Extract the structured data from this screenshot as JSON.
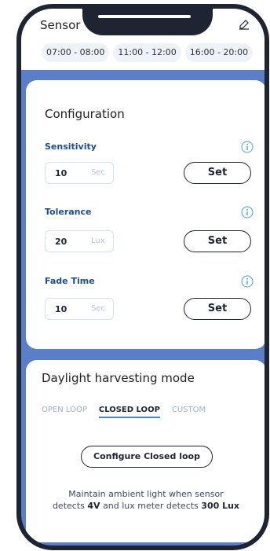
{
  "header": {
    "title": "Sensor",
    "edit_icon": "edit-icon",
    "time_slots": [
      "07:00 - 08:00",
      "11:00 - 12:00",
      "16:00 - 20:00"
    ]
  },
  "configuration": {
    "title": "Configuration",
    "rows": [
      {
        "label": "Sensitivity",
        "value": "10",
        "unit": "Sec",
        "button": "Set"
      },
      {
        "label": "Tolerance",
        "value": "20",
        "unit": "Lux",
        "button": "Set"
      },
      {
        "label": "Fade Time",
        "value": "10",
        "unit": "Sec",
        "button": "Set"
      }
    ]
  },
  "daylight": {
    "title": "Daylight harvesting mode",
    "tabs": [
      "OPEN LOOP",
      "CLOSED LOOP",
      "CUSTOM"
    ],
    "active_tab": "CLOSED LOOP",
    "configure_button": "Configure Closed loop",
    "description": {
      "line1": "Maintain ambient light when sensor",
      "line2_prefix": "detects",
      "voltage": "4V",
      "line2_mid": "and lux meter detects",
      "lux": "300 Lux"
    }
  },
  "colors": {
    "accent": "#5b7fc7",
    "label": "#1f4b8f",
    "info": "#4a9fd8"
  }
}
